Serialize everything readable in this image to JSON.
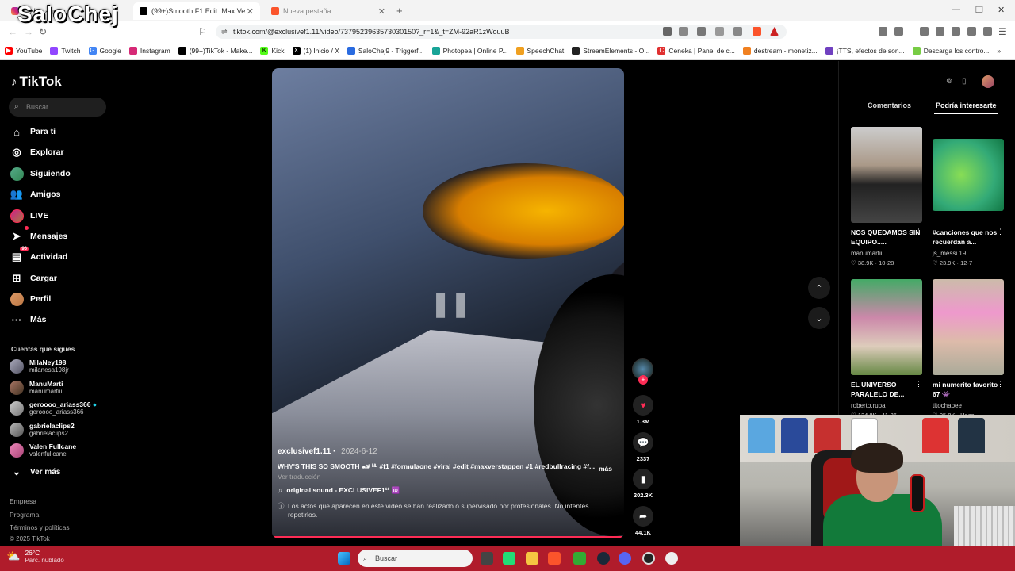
{
  "browser": {
    "tabs": [
      {
        "label": "(3) Instagram"
      },
      {
        "label": "(99+)Smooth F1 Edit: Max Ve"
      },
      {
        "label": "Nueva pestaña"
      }
    ],
    "url": "tiktok.com/@exclusivef1.11/video/7379523963573030150?_r=1&_t=ZM-92aR1zWouuB",
    "bookmarks": [
      "YouTube",
      "Twitch",
      "Google",
      "Instagram",
      "(99+)TikTok - Make...",
      "Kick",
      "(1) Inicio / X",
      "SaloChej9 - Triggerf...",
      "Photopea | Online P...",
      "SpeechChat",
      "StreamElements - O...",
      "Ceneka | Panel de c...",
      "destream - monetiz...",
      "¡TTS, efectos de son...",
      "Descarga los contro..."
    ]
  },
  "watermark": "SaloChej",
  "sidebar": {
    "logo": "TikTok",
    "search_placeholder": "Buscar",
    "nav": [
      {
        "label": "Para ti"
      },
      {
        "label": "Explorar"
      },
      {
        "label": "Siguiendo"
      },
      {
        "label": "Amigos"
      },
      {
        "label": "LIVE"
      },
      {
        "label": "Mensajes"
      },
      {
        "label": "Actividad",
        "badge": "96"
      },
      {
        "label": "Cargar"
      },
      {
        "label": "Perfil"
      },
      {
        "label": "Más"
      }
    ],
    "following_header": "Cuentas que sigues",
    "following": [
      {
        "name": "MilaNey198",
        "handle": "milanesa198jr"
      },
      {
        "name": "ManuMarti",
        "handle": "manumartiii"
      },
      {
        "name": "geroooo_ariass366",
        "handle": "geroooo_ariass366"
      },
      {
        "name": "gabrielaclips2",
        "handle": "gabrielaclips2"
      },
      {
        "name": "Valen Fullcane",
        "handle": "valenfullcane"
      }
    ],
    "see_more": "Ver más",
    "footer": [
      "Empresa",
      "Programa",
      "Términos y políticas",
      "© 2025 TikTok"
    ]
  },
  "video": {
    "author": "exclusivef1.11",
    "date": "2024-6-12",
    "caption": "WHY'S THIS SO SMOOTH 🏎 ᴺᴸ #f1 #formulaone #viral #edit #maxverstappen #1 #redbullracing #f...",
    "more": "más",
    "translate": "Ver traducción",
    "sound": "original sound - EXCLUSIVEF1¹¹ 🆔",
    "disclaimer": "Los actos que aparecen en este vídeo se han realizado o supervisado por profesionales. No intentes repetirlos."
  },
  "actions": {
    "likes": "1.3M",
    "comments": "2337",
    "saves": "202.3K",
    "shares": "44.1K"
  },
  "right_panel": {
    "tabs": [
      "Comentarios",
      "Podría interesarte"
    ],
    "items": [
      {
        "title": "NOS QUEDAMOS SIN EQUIPO.....",
        "author": "manumartiii",
        "likes": "38.9K",
        "date": "10-28"
      },
      {
        "title": "#canciones que nos recuerdan a...",
        "author": "js_messi.19",
        "likes": "23.9K",
        "date": "12-7"
      },
      {
        "title": "EL UNIVERSO PARALELO DE...",
        "author": "roberto.rupa",
        "likes": "134.8K",
        "date": "11-26"
      },
      {
        "title": "mi numerito favorito 67 👾",
        "author": "titochapee",
        "likes": "95.8K",
        "date": "Hace ..."
      }
    ]
  },
  "taskbar": {
    "temp": "26°C",
    "weather": "Parc. nublado",
    "search_placeholder": "Buscar"
  }
}
